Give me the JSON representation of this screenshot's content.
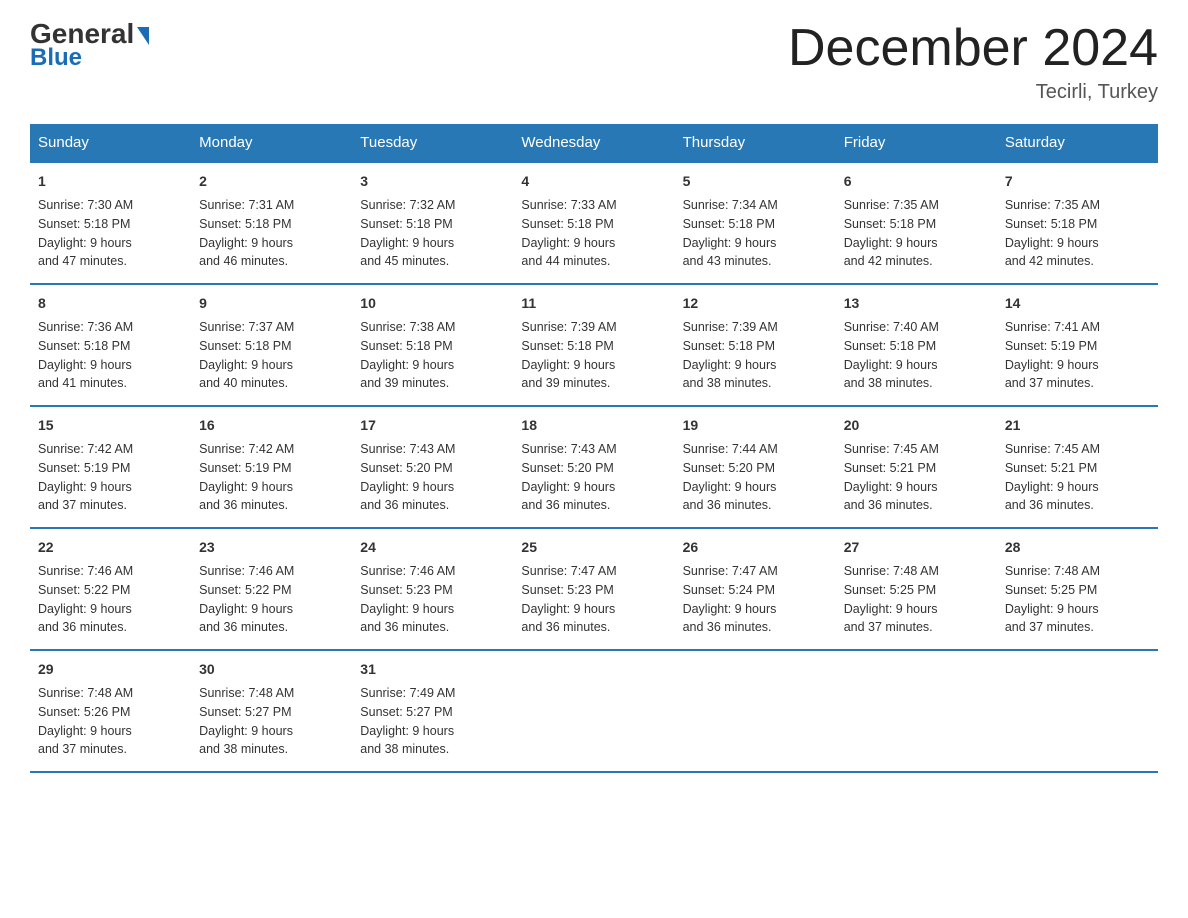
{
  "header": {
    "logo_line1": "General",
    "logo_line2": "Blue",
    "month_title": "December 2024",
    "location": "Tecirli, Turkey"
  },
  "days_of_week": [
    "Sunday",
    "Monday",
    "Tuesday",
    "Wednesday",
    "Thursday",
    "Friday",
    "Saturday"
  ],
  "weeks": [
    [
      {
        "day": "1",
        "sunrise": "7:30 AM",
        "sunset": "5:18 PM",
        "daylight": "9 hours and 47 minutes."
      },
      {
        "day": "2",
        "sunrise": "7:31 AM",
        "sunset": "5:18 PM",
        "daylight": "9 hours and 46 minutes."
      },
      {
        "day": "3",
        "sunrise": "7:32 AM",
        "sunset": "5:18 PM",
        "daylight": "9 hours and 45 minutes."
      },
      {
        "day": "4",
        "sunrise": "7:33 AM",
        "sunset": "5:18 PM",
        "daylight": "9 hours and 44 minutes."
      },
      {
        "day": "5",
        "sunrise": "7:34 AM",
        "sunset": "5:18 PM",
        "daylight": "9 hours and 43 minutes."
      },
      {
        "day": "6",
        "sunrise": "7:35 AM",
        "sunset": "5:18 PM",
        "daylight": "9 hours and 42 minutes."
      },
      {
        "day": "7",
        "sunrise": "7:35 AM",
        "sunset": "5:18 PM",
        "daylight": "9 hours and 42 minutes."
      }
    ],
    [
      {
        "day": "8",
        "sunrise": "7:36 AM",
        "sunset": "5:18 PM",
        "daylight": "9 hours and 41 minutes."
      },
      {
        "day": "9",
        "sunrise": "7:37 AM",
        "sunset": "5:18 PM",
        "daylight": "9 hours and 40 minutes."
      },
      {
        "day": "10",
        "sunrise": "7:38 AM",
        "sunset": "5:18 PM",
        "daylight": "9 hours and 39 minutes."
      },
      {
        "day": "11",
        "sunrise": "7:39 AM",
        "sunset": "5:18 PM",
        "daylight": "9 hours and 39 minutes."
      },
      {
        "day": "12",
        "sunrise": "7:39 AM",
        "sunset": "5:18 PM",
        "daylight": "9 hours and 38 minutes."
      },
      {
        "day": "13",
        "sunrise": "7:40 AM",
        "sunset": "5:18 PM",
        "daylight": "9 hours and 38 minutes."
      },
      {
        "day": "14",
        "sunrise": "7:41 AM",
        "sunset": "5:19 PM",
        "daylight": "9 hours and 37 minutes."
      }
    ],
    [
      {
        "day": "15",
        "sunrise": "7:42 AM",
        "sunset": "5:19 PM",
        "daylight": "9 hours and 37 minutes."
      },
      {
        "day": "16",
        "sunrise": "7:42 AM",
        "sunset": "5:19 PM",
        "daylight": "9 hours and 36 minutes."
      },
      {
        "day": "17",
        "sunrise": "7:43 AM",
        "sunset": "5:20 PM",
        "daylight": "9 hours and 36 minutes."
      },
      {
        "day": "18",
        "sunrise": "7:43 AM",
        "sunset": "5:20 PM",
        "daylight": "9 hours and 36 minutes."
      },
      {
        "day": "19",
        "sunrise": "7:44 AM",
        "sunset": "5:20 PM",
        "daylight": "9 hours and 36 minutes."
      },
      {
        "day": "20",
        "sunrise": "7:45 AM",
        "sunset": "5:21 PM",
        "daylight": "9 hours and 36 minutes."
      },
      {
        "day": "21",
        "sunrise": "7:45 AM",
        "sunset": "5:21 PM",
        "daylight": "9 hours and 36 minutes."
      }
    ],
    [
      {
        "day": "22",
        "sunrise": "7:46 AM",
        "sunset": "5:22 PM",
        "daylight": "9 hours and 36 minutes."
      },
      {
        "day": "23",
        "sunrise": "7:46 AM",
        "sunset": "5:22 PM",
        "daylight": "9 hours and 36 minutes."
      },
      {
        "day": "24",
        "sunrise": "7:46 AM",
        "sunset": "5:23 PM",
        "daylight": "9 hours and 36 minutes."
      },
      {
        "day": "25",
        "sunrise": "7:47 AM",
        "sunset": "5:23 PM",
        "daylight": "9 hours and 36 minutes."
      },
      {
        "day": "26",
        "sunrise": "7:47 AM",
        "sunset": "5:24 PM",
        "daylight": "9 hours and 36 minutes."
      },
      {
        "day": "27",
        "sunrise": "7:48 AM",
        "sunset": "5:25 PM",
        "daylight": "9 hours and 37 minutes."
      },
      {
        "day": "28",
        "sunrise": "7:48 AM",
        "sunset": "5:25 PM",
        "daylight": "9 hours and 37 minutes."
      }
    ],
    [
      {
        "day": "29",
        "sunrise": "7:48 AM",
        "sunset": "5:26 PM",
        "daylight": "9 hours and 37 minutes."
      },
      {
        "day": "30",
        "sunrise": "7:48 AM",
        "sunset": "5:27 PM",
        "daylight": "9 hours and 38 minutes."
      },
      {
        "day": "31",
        "sunrise": "7:49 AM",
        "sunset": "5:27 PM",
        "daylight": "9 hours and 38 minutes."
      },
      {
        "day": "",
        "sunrise": "",
        "sunset": "",
        "daylight": ""
      },
      {
        "day": "",
        "sunrise": "",
        "sunset": "",
        "daylight": ""
      },
      {
        "day": "",
        "sunrise": "",
        "sunset": "",
        "daylight": ""
      },
      {
        "day": "",
        "sunrise": "",
        "sunset": "",
        "daylight": ""
      }
    ]
  ],
  "labels": {
    "sunrise": "Sunrise:",
    "sunset": "Sunset:",
    "daylight": "Daylight:"
  }
}
